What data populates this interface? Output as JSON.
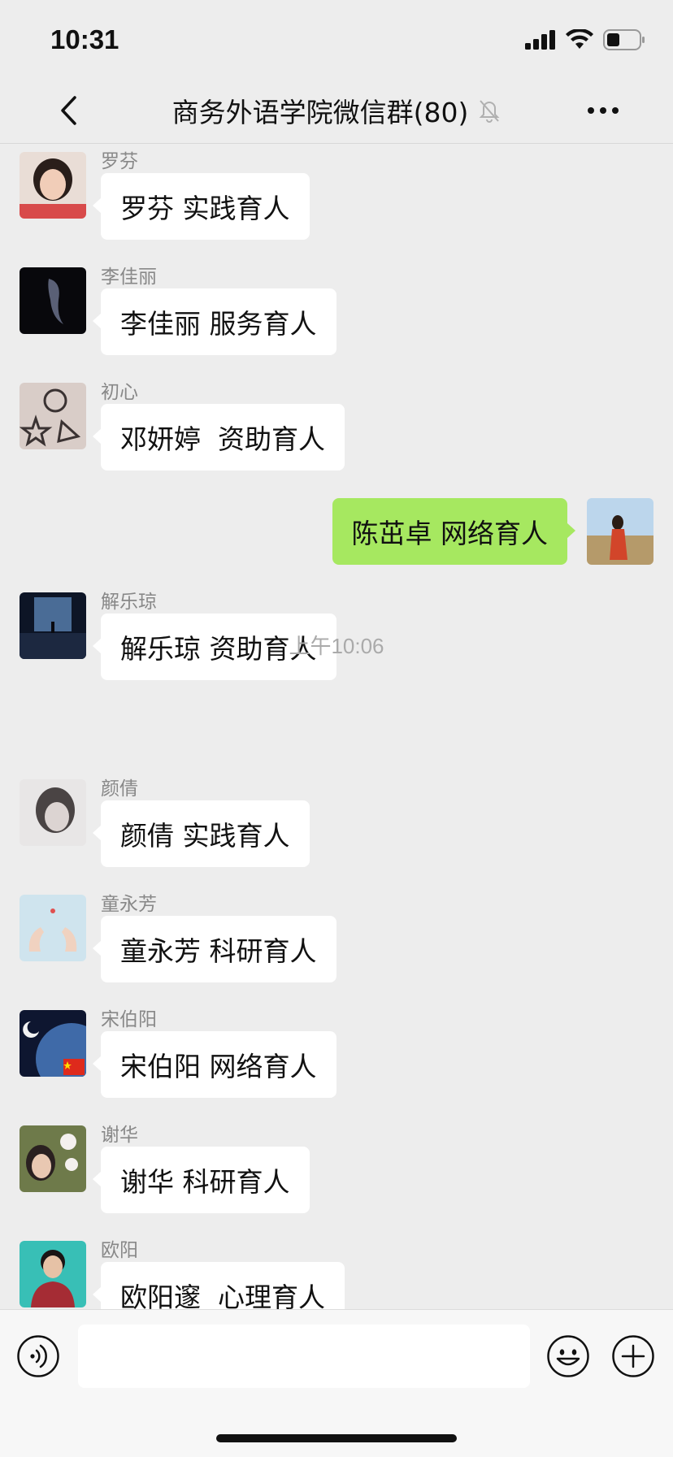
{
  "status_bar": {
    "time": "10:31"
  },
  "nav": {
    "title": "商务外语学院微信群(80)",
    "back_icon": "chevron-left-icon",
    "mute_icon": "bell-slash-icon",
    "more_icon": "ellipsis-icon"
  },
  "messages": [
    {
      "sender": "罗芬",
      "text": "罗芬 实践育人",
      "side": "left"
    },
    {
      "sender": "李佳丽",
      "text": "李佳丽 服务育人",
      "side": "left"
    },
    {
      "sender": "初心",
      "text": "邓妍婷  资助育人",
      "side": "left"
    },
    {
      "sender": "",
      "text": "陈茁卓 网络育人",
      "side": "right"
    },
    {
      "sender": "解乐琼",
      "text": "解乐琼 资助育人",
      "side": "left"
    }
  ],
  "timestamp": "上午10:06",
  "messages2": [
    {
      "sender": "颜倩",
      "text": "颜倩 实践育人",
      "side": "left"
    },
    {
      "sender": "童永芳",
      "text": "童永芳 科研育人",
      "side": "left"
    },
    {
      "sender": "宋伯阳",
      "text": "宋伯阳 网络育人",
      "side": "left"
    },
    {
      "sender": "谢华",
      "text": "谢华 科研育人",
      "side": "left"
    },
    {
      "sender": "欧阳",
      "text": "欧阳邃  心理育人",
      "side": "left"
    }
  ],
  "input_bar": {
    "input_value": "",
    "voice_icon": "voice-icon",
    "emoji_icon": "emoji-icon",
    "plus_icon": "plus-circle-icon"
  },
  "colors": {
    "background": "#ededed",
    "own_bubble": "#a6e860",
    "other_bubble": "#ffffff"
  }
}
